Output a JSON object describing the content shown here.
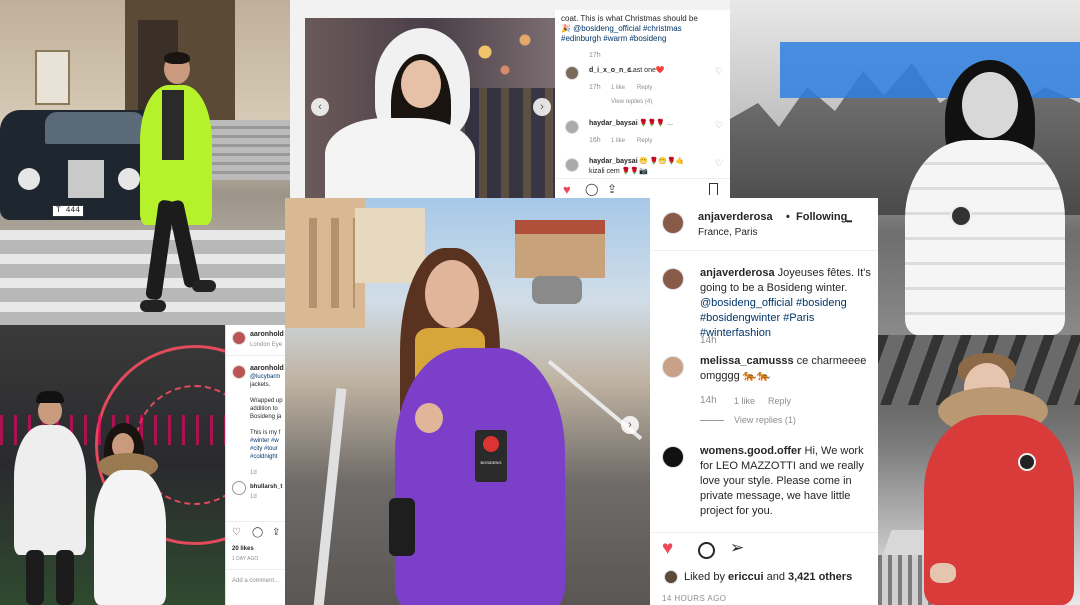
{
  "top_left_photo": {
    "plate": "T 444"
  },
  "post_top": {
    "caption_line1": "coat. This is what Christmas should be",
    "caption_line2": "🎉 @bosideng_official #christmas",
    "caption_line3": "#edinburgh #warm #bosideng",
    "caption_time": "17h",
    "comments": [
      {
        "user": "d_i_x_o_n_c",
        "text": "Last one❤️",
        "time": "17h",
        "likes": "1 like",
        "reply": "Reply",
        "view_replies": "View replies (4)"
      },
      {
        "user": "haydar_baysai",
        "text": "🌹🌹🌹 ...",
        "time": "16h",
        "likes": "1 like",
        "reply": "Reply"
      },
      {
        "user": "haydar_baysai",
        "text": "😁 🌹😁🌹🤙",
        "text2": "kizali cem 🌹🌹📷"
      }
    ]
  },
  "post_left": {
    "user1": "aaronhold",
    "location": "London Eye",
    "user2": "aaronhold",
    "caption": [
      "@lucybarm",
      "jackets.",
      "",
      "Wrapped up",
      "addition to",
      "Bosideng ja",
      "",
      "This is my f",
      "#winter #w",
      "#city #tour",
      "#coldnight"
    ],
    "time": "1d",
    "commenter": "bhullarsh_t",
    "commenter_time": "1d",
    "likes": "20 likes",
    "date": "1 DAY AGO",
    "add_comment": "Add a comment..."
  },
  "post_main": {
    "username": "anjaverderosa",
    "dot": "•",
    "following": "Following",
    "location": "France, Paris",
    "more": "•••",
    "caption_user": "anjaverderosa",
    "caption_text": "Joyeuses fêtes. It's",
    "caption_line2": "going to be a Bosideng winter.",
    "caption_line3": "@bosideng_official #bosideng",
    "caption_line4": "#bosidengwinter #Paris #winterfashion",
    "caption_time": "14h",
    "comment1_user": "melissa_camusss",
    "comment1_text": "ce charmeeee",
    "comment1_text2": "omgggg 🐅🐅",
    "comment1_time": "14h",
    "comment1_likes": "1 like",
    "comment1_reply": "Reply",
    "comment1_view": "View replies (1)",
    "comment2_user": "womens.good.offer",
    "comment2_lines": [
      "Hi, We work",
      "for LEO MAZZOTTI and we really",
      "love your style. Please come in",
      "private message, we have little",
      "project for you."
    ],
    "liked_prefix": "Liked by",
    "liked_user": "ericcui",
    "liked_and": "and",
    "liked_count": "3,421 others",
    "date": "14 HOURS AGO",
    "badge_text": "BOSIDENG"
  },
  "colors": {
    "neon": "#b6f22b",
    "purple": "#7b3fc9",
    "red_jacket": "#d93a3a",
    "blue_overlay": "#2f7fe0",
    "heart": "#ed4956",
    "link": "#003569"
  }
}
